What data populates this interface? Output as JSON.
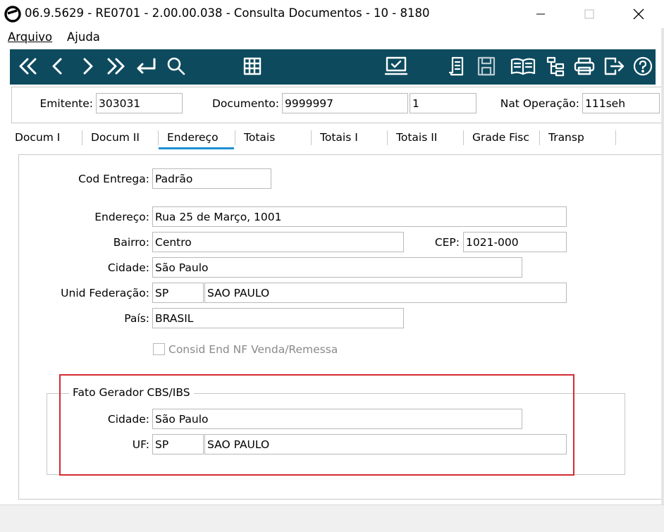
{
  "window": {
    "title": "06.9.5629 - RE0701 - 2.00.00.038 - Consulta Documentos - 10 - 8180",
    "minimize": "—",
    "maximize": "☐",
    "close": "✕"
  },
  "menu": {
    "arquivo": "Arquivo",
    "ajuda": "Ajuda"
  },
  "colors": {
    "toolbar_bg": "#0d4a5e",
    "highlight_box": "#d32b32",
    "active_tab_underline": "#1e90d6"
  },
  "toolbar": {
    "icons": [
      "first-icon",
      "previous-icon",
      "next-icon",
      "last-icon",
      "goto-icon",
      "search-icon",
      "grid-icon",
      "check-screen-icon",
      "notepad-icon",
      "save-icon",
      "book-icon",
      "tree-icon",
      "print-icon",
      "exit-icon",
      "help-icon"
    ]
  },
  "header": {
    "emitente_label": "Emitente:",
    "emitente_value": "303031",
    "documento_label": "Documento:",
    "documento_value": "9999997",
    "serie_value": "1",
    "natop_label": "Nat Operação:",
    "natop_value": "111seh"
  },
  "tabs": [
    "Docum I",
    "Docum II",
    "Endereço",
    "Totais",
    "Totais I",
    "Totais II",
    "Grade Fisc",
    "Transp"
  ],
  "active_tab": "Endereço",
  "form": {
    "cod_entrega_label": "Cod Entrega:",
    "cod_entrega_value": "Padrão",
    "endereco_label": "Endereço:",
    "endereco_value": "Rua 25 de Março, 1001",
    "bairro_label": "Bairro:",
    "bairro_value": "Centro",
    "cep_label": "CEP:",
    "cep_value": "1021-000",
    "cidade_label": "Cidade:",
    "cidade_value": "São Paulo",
    "uf_label": "Unid Federação:",
    "uf_code": "SP",
    "uf_name": "SAO PAULO",
    "pais_label": "País:",
    "pais_value": "BRASIL",
    "consid_label": "Consid End NF Venda/Remessa",
    "consid_checked": false
  },
  "fato_gerador": {
    "title": "Fato Gerador CBS/IBS",
    "cidade_label": "Cidade:",
    "cidade_value": "São Paulo",
    "uf_label": "UF:",
    "uf_code": "SP",
    "uf_name": "SAO PAULO"
  }
}
